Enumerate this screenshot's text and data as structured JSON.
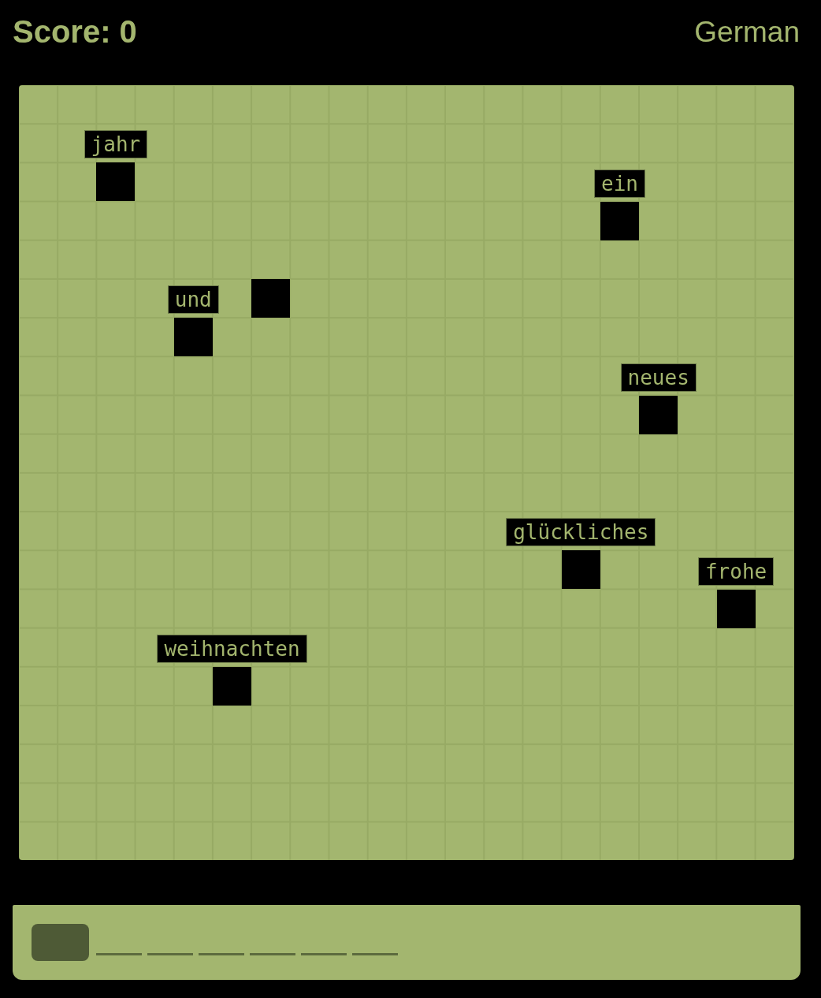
{
  "header": {
    "score": "Score: 0",
    "language": "German"
  },
  "board": {
    "words": [
      "jahr",
      "ein",
      "und",
      "neues",
      "glückliches",
      "frohe",
      "weihnachten"
    ]
  },
  "answer_slots": [
    {
      "selected": true
    },
    {
      "selected": false
    },
    {
      "selected": false
    },
    {
      "selected": false
    },
    {
      "selected": false
    },
    {
      "selected": false
    },
    {
      "selected": false
    }
  ]
}
